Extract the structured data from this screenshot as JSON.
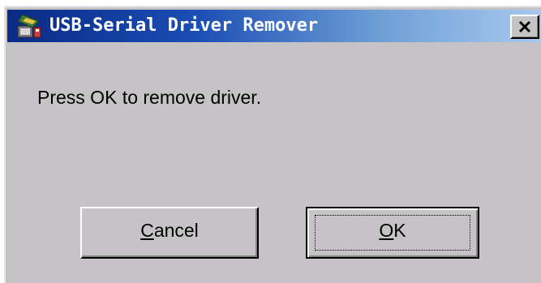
{
  "window": {
    "title": "USB-Serial Driver Remover",
    "app_icon": "driver-app-icon",
    "close_icon": "close-icon"
  },
  "dialog": {
    "message": "Press OK to remove driver."
  },
  "buttons": {
    "cancel": {
      "mnemonic": "C",
      "rest": "ancel"
    },
    "ok": {
      "mnemonic": "O",
      "rest": "K"
    }
  },
  "colors": {
    "face": "#c6c3c6",
    "title_start": "#0a2a86",
    "title_end": "#a8c8ee"
  }
}
